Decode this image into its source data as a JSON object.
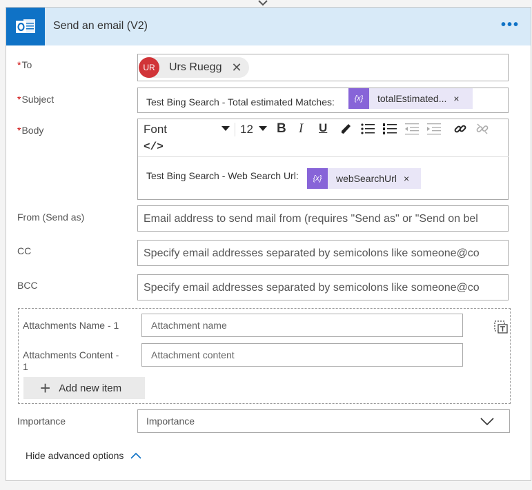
{
  "action": {
    "title": "Send an email (V2)",
    "more_label": "•••"
  },
  "to": {
    "label": "To",
    "required": "*",
    "recipient_initials": "UR",
    "recipient_name": "Urs Ruegg",
    "remove_glyph": "✕"
  },
  "subject": {
    "label": "Subject",
    "required": "*",
    "text": "Test Bing Search - Total estimated Matches:",
    "token_label": "totalEstimated...",
    "token_remove": "×",
    "token_icon": "{x}"
  },
  "body": {
    "label": "Body",
    "required": "*",
    "font": "Font",
    "font_size": "12",
    "bold": "B",
    "italic": "I",
    "underline": "U",
    "code_view": "</>",
    "text": "Test Bing Search - Web Search Url:",
    "token_label": "webSearchUrl",
    "token_remove": "×",
    "token_icon": "{x}"
  },
  "from": {
    "label": "From (Send as)",
    "placeholder": "Email address to send mail from (requires \"Send as\" or \"Send on bel"
  },
  "cc": {
    "label": "CC",
    "placeholder": "Specify email addresses separated by semicolons like someone@co"
  },
  "bcc": {
    "label": "BCC",
    "placeholder": "Specify email addresses separated by semicolons like someone@co"
  },
  "attachments": {
    "name_label": "Attachments Name - 1",
    "name_placeholder": "Attachment name",
    "content_label_line1": "Attachments Content -",
    "content_label_line2": "1",
    "content_placeholder": "Attachment content",
    "add_item": "Add new item",
    "add_glyph": "+"
  },
  "importance": {
    "label": "Importance",
    "value": "Importance"
  },
  "advanced": {
    "toggle_label": "Hide advanced options"
  },
  "colors": {
    "header_bg": "#d8eaf8",
    "outlook_blue": "#0f72c6",
    "token_purple": "#8764d8",
    "avatar_red": "#d13438"
  }
}
